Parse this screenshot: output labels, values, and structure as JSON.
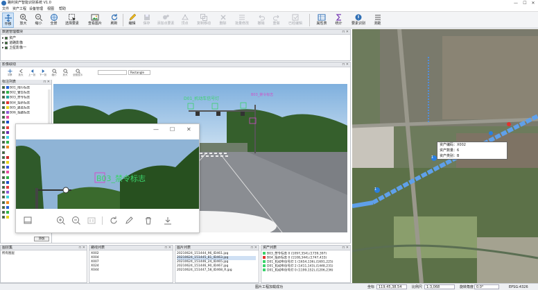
{
  "app": {
    "title": "路利资产智能识别系统 V1.0"
  },
  "window_controls": {
    "minimize": "—",
    "maximize": "☐",
    "close": "✕"
  },
  "menu": [
    "文件",
    "资产工程",
    "设备管理",
    "视图",
    "帮助"
  ],
  "ribbon": {
    "buttons": [
      {
        "label": "平移",
        "icon": "pan-icon",
        "active": true
      },
      {
        "label": "放大",
        "icon": "zoom-in-icon"
      },
      {
        "label": "缩小",
        "icon": "zoom-out-icon"
      },
      {
        "label": "全景",
        "icon": "full-extent-icon"
      },
      {
        "label": "选择要素",
        "icon": "select-feature-icon"
      },
      {
        "label": "查看图片",
        "icon": "view-image-icon"
      },
      {
        "label": "刷新",
        "icon": "refresh-icon"
      },
      {
        "label": "编辑",
        "icon": "edit-icon"
      },
      {
        "label": "保存",
        "icon": "save-icon",
        "disabled": true
      },
      {
        "label": "添加点要素",
        "icon": "add-point-icon",
        "disabled": true
      },
      {
        "label": "顶点",
        "icon": "vertex-icon",
        "disabled": true
      },
      {
        "label": "复制移动",
        "icon": "copy-move-icon",
        "disabled": true
      },
      {
        "label": "删除",
        "icon": "delete-icon",
        "disabled": true
      },
      {
        "label": "批量修改",
        "icon": "batch-edit-icon",
        "disabled": true
      },
      {
        "label": "撤销",
        "icon": "undo-icon",
        "disabled": true
      },
      {
        "label": "重做",
        "icon": "redo-icon",
        "disabled": true
      },
      {
        "label": "已经编辑",
        "icon": "edited-icon",
        "disabled": true
      },
      {
        "label": "属性表",
        "icon": "attribute-table-icon"
      },
      {
        "label": "统计",
        "icon": "statistics-icon"
      },
      {
        "label": "要素识别",
        "icon": "feature-recognition-icon"
      },
      {
        "label": "测距",
        "icon": "measure-icon"
      }
    ]
  },
  "layer_panel": {
    "title": "数据管理模块",
    "items": [
      {
        "label": "资产",
        "checked": true
      },
      {
        "label": "道路影像",
        "checked": true
      },
      {
        "label": "卫星影像一",
        "checked": true
      }
    ]
  },
  "image_panel": {
    "title": "影像取动",
    "tools": [
      "平移",
      "放大",
      "上一张",
      "下一张",
      "缩小",
      "放大",
      "全图显示"
    ],
    "combo1": "",
    "combo2": "Rectangle",
    "legend_title": "标注列表",
    "legend": [
      {
        "label": "B01_限行标志",
        "color": "#2b64d8"
      },
      {
        "label": "B02_警告标志",
        "color": "#2fb34a"
      },
      {
        "label": "B03_禁令标志",
        "color": "#24a6a0"
      },
      {
        "label": "B04_指示标志",
        "color": "#e1322d"
      },
      {
        "label": "B05_路名标志",
        "color": "#e7d21d"
      },
      {
        "label": "B06_指路标志",
        "color": "#8f5bd6"
      },
      {
        "label": "",
        "color": "#e64fa3"
      },
      {
        "label": "",
        "color": "#1e4fc8"
      },
      {
        "label": "",
        "color": "#e53f3f"
      },
      {
        "label": "",
        "color": "#6b2fb0"
      },
      {
        "label": "",
        "color": "#3fd3e0"
      },
      {
        "label": "",
        "color": "#31b24a"
      },
      {
        "label": "",
        "color": "#f08a24"
      },
      {
        "label": "",
        "color": "#ffffff"
      },
      {
        "label": "",
        "color": "#d12f2f"
      },
      {
        "label": "",
        "color": "#e7d21d"
      },
      {
        "label": "",
        "color": "#3a58e0"
      },
      {
        "label": "",
        "color": "#e64fa3"
      },
      {
        "label": "",
        "color": "#2fb34a"
      },
      {
        "label": "",
        "color": "#1e4fc8"
      },
      {
        "label": "",
        "color": "#e53f3f"
      },
      {
        "label": "",
        "color": "#8f5bd6"
      },
      {
        "label": "",
        "color": "#3fd3e0"
      },
      {
        "label": "",
        "color": "#f08a24"
      },
      {
        "label": "",
        "color": "#2b64d8"
      },
      {
        "label": "",
        "color": "#2fb34a"
      },
      {
        "label": "",
        "color": "#e7d21d"
      }
    ],
    "add_button": "添加",
    "annotations": [
      {
        "text": "D01_机动车信号灯",
        "color": "#3bd36b"
      },
      {
        "text": "B03_禁令标志",
        "color": "#d04fc8"
      }
    ]
  },
  "popup": {
    "annotation": "B03_禁令标志"
  },
  "bottom_panels": {
    "catalog": {
      "title": "图层集",
      "item": "所有图层"
    },
    "road_list": {
      "title": "路线列表",
      "items": [
        "X002",
        "X004",
        "X007",
        "X024",
        "X044"
      ]
    },
    "photo_list": {
      "title": "图片列表",
      "items": [
        "20210624_151444_96_ID461.jpg",
        "20210624_151445_81_ID463.jpg",
        "20210624_151446_24_ID465.jpg",
        "20210624_151446_90_ID467.jpg",
        "20210624_151447_58_ID468_R.jpg"
      ],
      "selected": 1
    },
    "asset_list": {
      "title": "资产列表",
      "items": [
        {
          "text": "B03_禁令标志 0 (1097,354),(1739,397)",
          "color": "#3bd36b"
        },
        {
          "text": "B04_指示标志 0 (1108,344),(1747,433)",
          "color": "#e1322d"
        },
        {
          "text": "D01_机动车信号灯 1 (1654,136),(1691,225)",
          "color": "#3bd36b"
        },
        {
          "text": "D01_机动车信号灯 2 (1411,143),(1448,231)",
          "color": "#3bd36b"
        },
        {
          "text": "D01_机动车信号灯 0 (1199,152),(1206,236)",
          "color": "#3bd36b"
        }
      ]
    }
  },
  "map": {
    "tooltip": [
      "资产编码：X002",
      "资产数量：6",
      "资产类别：B"
    ],
    "markers": [
      "1",
      "1",
      "1"
    ]
  },
  "status": {
    "center": "图片工程加载成功",
    "coord_label": "坐标",
    "coord_value": "119.45,38.54",
    "scale_label": "比例尺",
    "scale_value": "1:3,068",
    "rotation_label": "旋转角度",
    "rotation_value": "0.0°",
    "crs": "EPSG:4326"
  },
  "colors": {
    "accent": "#2f6fb5",
    "road_blue": "#2a7fe0"
  }
}
